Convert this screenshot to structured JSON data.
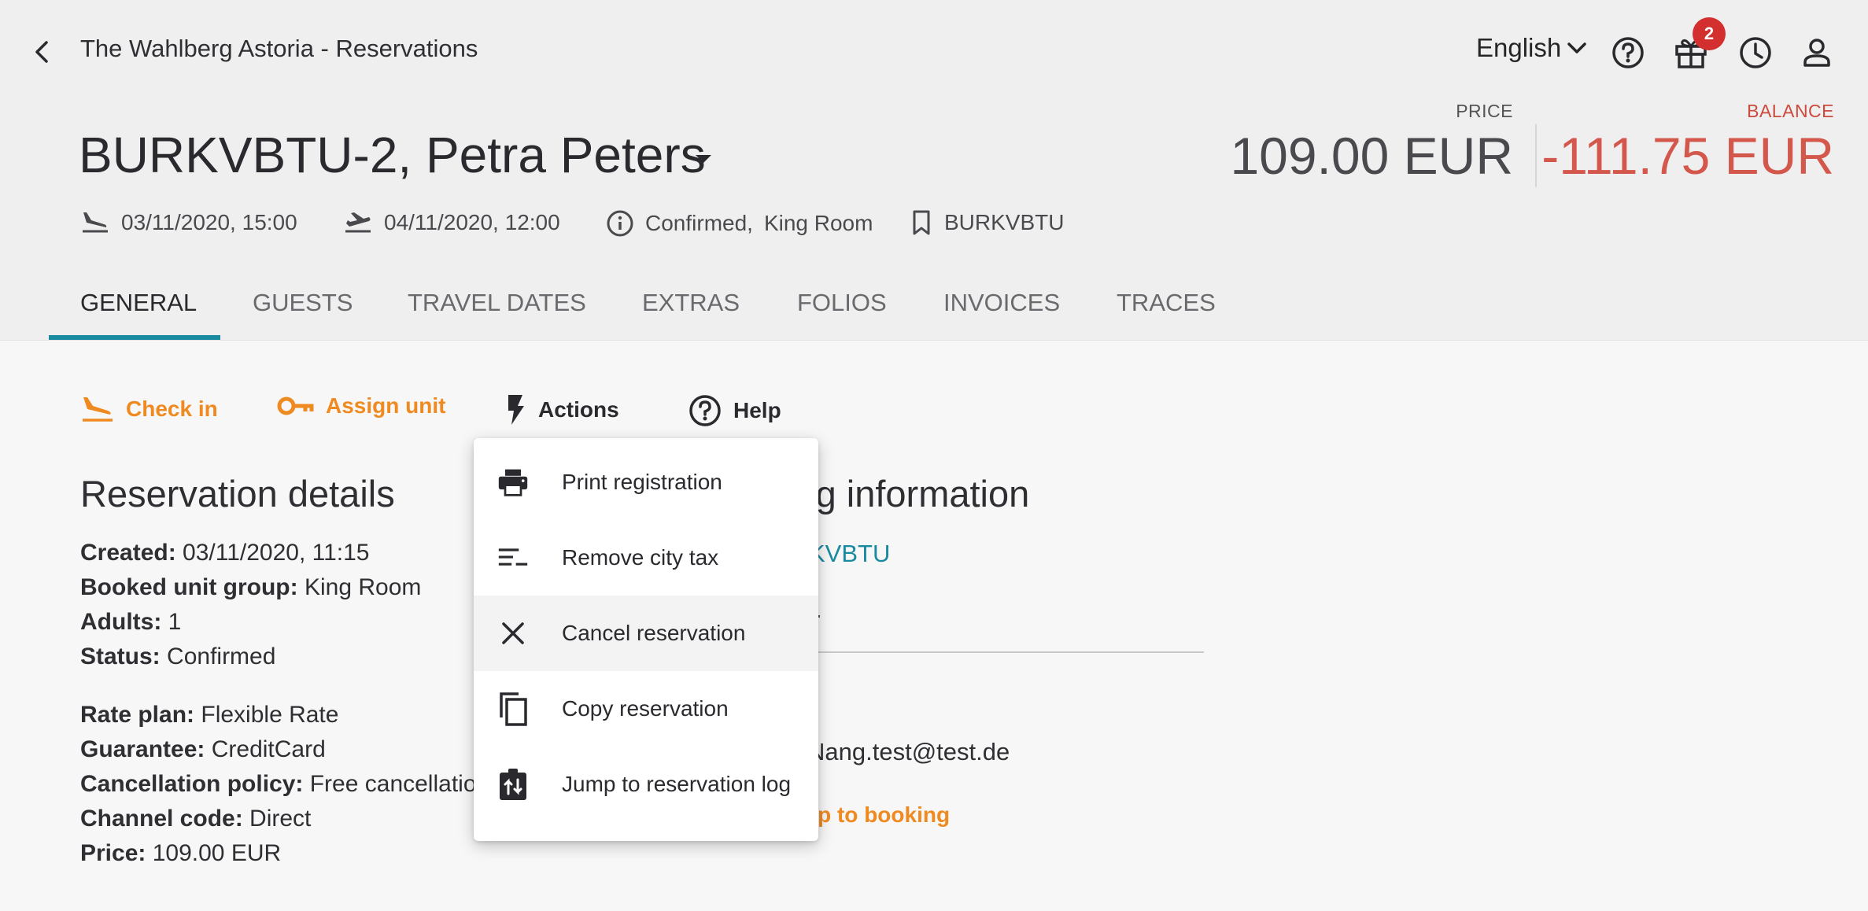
{
  "header": {
    "app_title": "The Wahlberg Astoria - Reservations",
    "language": "English",
    "notification_count": "2"
  },
  "reservation": {
    "title": "BURKVBTU-2, Petra Peters",
    "arrival": "03/11/2020, 15:00",
    "departure": "04/11/2020, 12:00",
    "status": "Confirmed,",
    "unit_group": "King Room",
    "booking_id": "BURKVBTU",
    "price_label": "PRICE",
    "price_value": "109.00 EUR",
    "balance_label": "BALANCE",
    "balance_value": "-111.75 EUR"
  },
  "tabs": [
    {
      "label": "GENERAL"
    },
    {
      "label": "GUESTS"
    },
    {
      "label": "TRAVEL DATES"
    },
    {
      "label": "EXTRAS"
    },
    {
      "label": "FOLIOS"
    },
    {
      "label": "INVOICES"
    },
    {
      "label": "TRACES"
    }
  ],
  "actions": {
    "check_in": "Check in",
    "assign_unit": "Assign unit",
    "actions": "Actions",
    "help": "Help"
  },
  "reservation_details": {
    "title": "Reservation details",
    "rows": [
      {
        "label": "Created:",
        "value": "03/11/2020, 11:15"
      },
      {
        "label": "Booked unit group:",
        "value": "King Room"
      },
      {
        "label": "Adults:",
        "value": "1"
      },
      {
        "label": "Status:",
        "value": "Confirmed"
      },
      {
        "label": "Rate plan:",
        "value": "Flexible Rate"
      },
      {
        "label": "Guarantee:",
        "value": "CreditCard"
      },
      {
        "label": "Cancellation policy:",
        "value": "Free cancellatio"
      },
      {
        "label": "Channel code:",
        "value": "Direct"
      },
      {
        "label": "Price:",
        "value": "109.00 EUR"
      }
    ]
  },
  "booking_information": {
    "title_fragment": "ing information",
    "booking_link_fragment": "KVBTU",
    "email_fragment": "Nang.test@test.de",
    "jump_fragment": "np to booking"
  },
  "actions_menu": {
    "items": [
      {
        "label": "Print registration",
        "icon": "printer-icon"
      },
      {
        "label": "Remove city tax",
        "icon": "sort-lines-icon"
      },
      {
        "label": "Cancel reservation",
        "icon": "close-icon"
      },
      {
        "label": "Copy reservation",
        "icon": "copy-icon"
      },
      {
        "label": "Jump to reservation log",
        "icon": "log-icon"
      }
    ]
  },
  "colors": {
    "accent_teal": "#1a8aa0",
    "accent_orange": "#ef8a21",
    "balance_red": "#d4574c",
    "badge_red": "#d32f2f"
  }
}
